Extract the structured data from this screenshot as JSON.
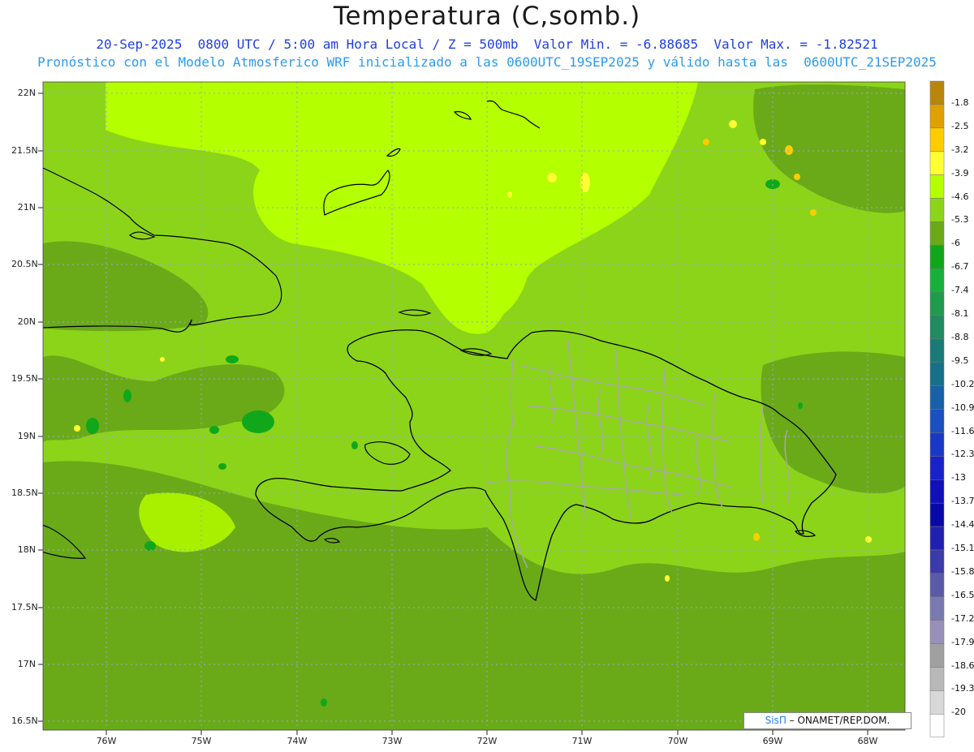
{
  "header": {
    "title": "Temperatura (C,somb.)",
    "line1": "20-Sep-2025  0800 UTC / 5:00 am Hora Local / Z = 500mb  Valor Min. = -6.88685  Valor Max. = -1.82521",
    "line2": "Pronóstico con el Modelo Atmosferico WRF inicializado a las 0600UTC_19SEP2025 y válido hasta las  0600UTC_21SEP2025"
  },
  "axes": {
    "lat_labels": [
      "22N",
      "21.5N",
      "21N",
      "20.5N",
      "20N",
      "19.5N",
      "19N",
      "18.5N",
      "18N",
      "17.5N",
      "17N",
      "16.5N"
    ],
    "lon_labels": [
      "76W",
      "75W",
      "74W",
      "73W",
      "72W",
      "71W",
      "70W",
      "69W",
      "68W"
    ]
  },
  "colorbar": {
    "labels": [
      "-1.8",
      "-2.5",
      "-3.2",
      "-3.9",
      "-4.6",
      "-5.3",
      "-6",
      "-6.7",
      "-7.4",
      "-8.1",
      "-8.8",
      "-9.5",
      "-10.2",
      "-10.9",
      "-11.6",
      "-12.3",
      "-13",
      "-13.7",
      "-14.4",
      "-15.1",
      "-15.8",
      "-16.5",
      "-17.2",
      "-17.9",
      "-18.6",
      "-19.3",
      "-20"
    ],
    "colors": [
      "#b8860b",
      "#e0a000",
      "#ffcc00",
      "#ffff33",
      "#b4ff00",
      "#8cd41a",
      "#6aaa18",
      "#10a81a",
      "#18b03c",
      "#1e9c4c",
      "#208a60",
      "#1a7a78",
      "#167088",
      "#1860a8",
      "#1a50c0",
      "#1a38c8",
      "#1822c8",
      "#1010b8",
      "#0808a8",
      "#2020b0",
      "#3a3aa8",
      "#5a5aa8",
      "#7a7ab0",
      "#9890b8",
      "#a0a0a0",
      "#b8b8b8",
      "#d8d8d8"
    ]
  },
  "credit": {
    "sis": "SisΠ",
    "rest": "– ONAMET/REP.DOM."
  }
}
